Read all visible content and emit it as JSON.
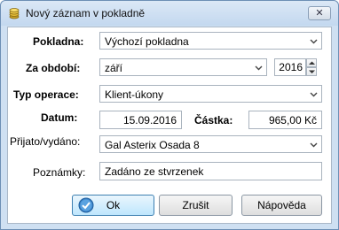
{
  "window": {
    "title": "Nový záznam v pokladně"
  },
  "form": {
    "pokladna_label": "Pokladna:",
    "pokladna_value": "Výchozí pokladna",
    "obdobi_label": "Za období:",
    "obdobi_month": "září",
    "obdobi_year": "2016",
    "typ_label": "Typ operace:",
    "typ_value": "Klient-úkony",
    "datum_label": "Datum:",
    "datum_value": "15.09.2016",
    "castka_label": "Částka:",
    "castka_value": "965,00 Kč",
    "prijato_label": "Přijato/vydáno:",
    "prijato_value": "Gal Asterix Osada 8",
    "poznamky_label": "Poznámky:",
    "poznamky_value": "Zadáno ze stvrzenek"
  },
  "buttons": {
    "ok": "Ok",
    "zrusit": "Zrušit",
    "napoveda": "Nápověda"
  },
  "icons": {
    "window": "coins-icon",
    "ok": "ok-check-icon",
    "close": "close-icon"
  }
}
